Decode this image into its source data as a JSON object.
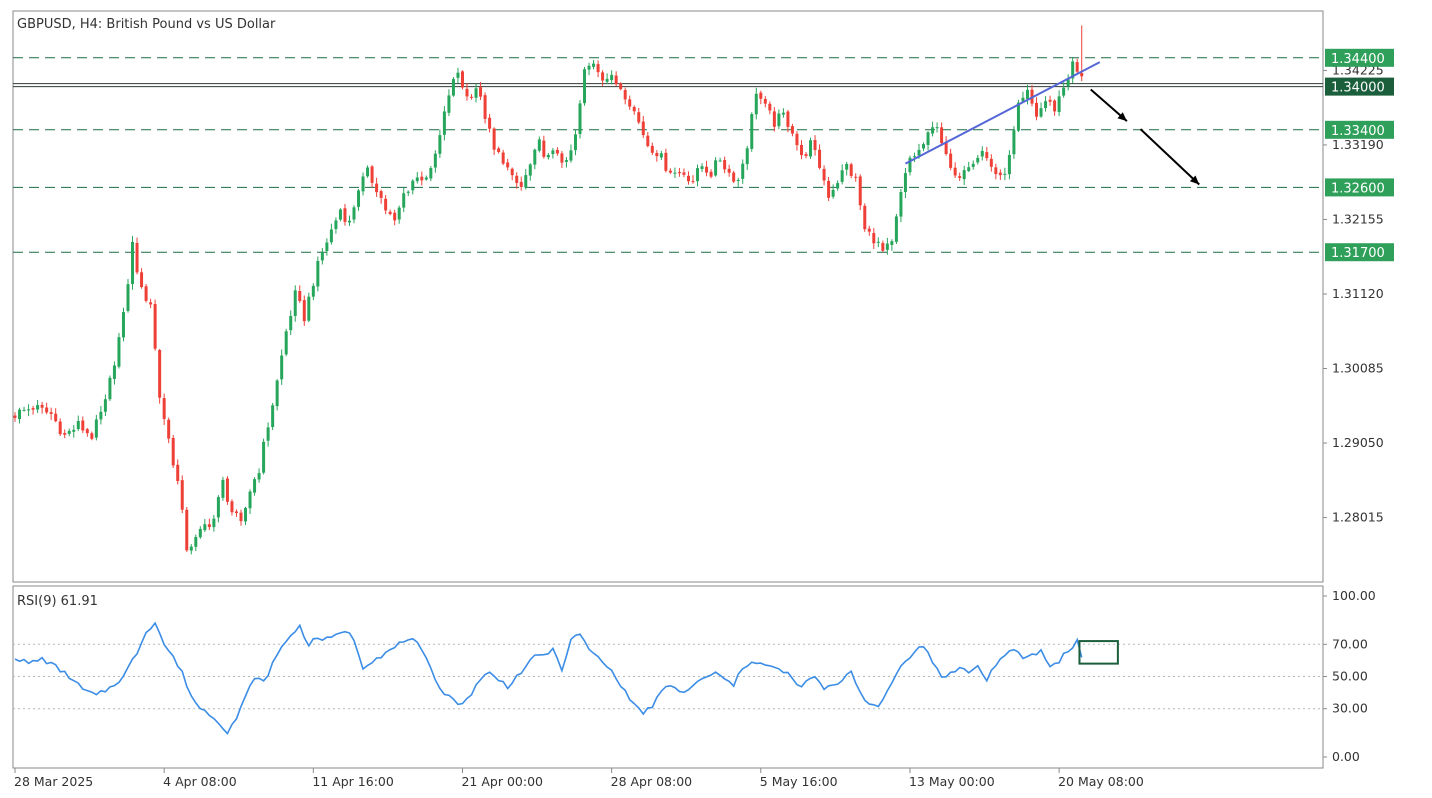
{
  "header": {
    "title": "GBPUSD, H4:  British Pound vs US Dollar"
  },
  "indicator": {
    "label": "RSI(9) 61.91"
  },
  "colors": {
    "bull": "#26a65b",
    "bear": "#ef4037",
    "grid_dash": "#1d6b45",
    "badge_fill": "#2ea05a",
    "badge_dark": "#1a5e3b",
    "trendline": "#5466d8",
    "rsi": "#3b8de6",
    "arrow": "#000000"
  },
  "chart_data": [
    {
      "type": "candlestick",
      "symbol": "GBPUSD",
      "timeframe": "H4",
      "x_ticks": [
        "28 Mar 2025",
        "4 Apr 08:00",
        "11 Apr 16:00",
        "21 Apr 00:00",
        "28 Apr 08:00",
        "5 May 16:00",
        "13 May 00:00",
        "20 May 08:00"
      ],
      "y_ticks": [
        "1.34225",
        "1.33190",
        "1.32155",
        "1.31120",
        "1.30085",
        "1.29050",
        "1.28015"
      ],
      "y_tick_values": [
        1.34225,
        1.3319,
        1.32155,
        1.3112,
        1.30085,
        1.2905,
        1.28015
      ],
      "ylim": [
        1.2712,
        1.3505
      ],
      "levels": [
        {
          "value": 1.344,
          "label": "1.34400",
          "style": "dashed"
        },
        {
          "value": 1.34,
          "label": "1.34000",
          "style": "solid"
        },
        {
          "value": 1.334,
          "label": "1.33400",
          "style": "dashed"
        },
        {
          "value": 1.326,
          "label": "1.32600",
          "style": "dashed"
        },
        {
          "value": 1.317,
          "label": "1.31700",
          "style": "dashed"
        }
      ],
      "anchors": [
        [
          0,
          1.2945
        ],
        [
          4,
          1.2955
        ],
        [
          8,
          1.2945
        ],
        [
          11,
          1.2915
        ],
        [
          14,
          1.293
        ],
        [
          17,
          1.2915
        ],
        [
          20,
          1.296
        ],
        [
          24,
          1.308
        ],
        [
          26,
          1.318
        ],
        [
          28,
          1.3115
        ],
        [
          30,
          1.31
        ],
        [
          32,
          1.297
        ],
        [
          34,
          1.291
        ],
        [
          36,
          1.285
        ],
        [
          38,
          1.276
        ],
        [
          40,
          1.277
        ],
        [
          42,
          1.279
        ],
        [
          44,
          1.28
        ],
        [
          46,
          1.285
        ],
        [
          48,
          1.281
        ],
        [
          50,
          1.279
        ],
        [
          52,
          1.284
        ],
        [
          54,
          1.287
        ],
        [
          56,
          1.293
        ],
        [
          58,
          1.299
        ],
        [
          60,
          1.306
        ],
        [
          62,
          1.311
        ],
        [
          64,
          1.308
        ],
        [
          66,
          1.313
        ],
        [
          68,
          1.317
        ],
        [
          70,
          1.32
        ],
        [
          72,
          1.323
        ],
        [
          74,
          1.321
        ],
        [
          76,
          1.326
        ],
        [
          78,
          1.328
        ],
        [
          80,
          1.326
        ],
        [
          82,
          1.323
        ],
        [
          84,
          1.321
        ],
        [
          86,
          1.325
        ],
        [
          88,
          1.327
        ],
        [
          90,
          1.3275
        ],
        [
          92,
          1.328
        ],
        [
          94,
          1.333
        ],
        [
          96,
          1.339
        ],
        [
          98,
          1.342
        ],
        [
          100,
          1.3385
        ],
        [
          102,
          1.34
        ],
        [
          104,
          1.336
        ],
        [
          106,
          1.331
        ],
        [
          108,
          1.33
        ],
        [
          110,
          1.327
        ],
        [
          112,
          1.326
        ],
        [
          114,
          1.329
        ],
        [
          116,
          1.332
        ],
        [
          118,
          1.33
        ],
        [
          120,
          1.331
        ],
        [
          122,
          1.329
        ],
        [
          124,
          1.333
        ],
        [
          126,
          1.342
        ],
        [
          128,
          1.3435
        ],
        [
          130,
          1.3415
        ],
        [
          132,
          1.341
        ],
        [
          134,
          1.34
        ],
        [
          136,
          1.338
        ],
        [
          138,
          1.335
        ],
        [
          140,
          1.332
        ],
        [
          142,
          1.331
        ],
        [
          144,
          1.329
        ],
        [
          146,
          1.328
        ],
        [
          148,
          1.328
        ],
        [
          150,
          1.327
        ],
        [
          152,
          1.329
        ],
        [
          154,
          1.328
        ],
        [
          156,
          1.33
        ],
        [
          158,
          1.328
        ],
        [
          160,
          1.327
        ],
        [
          162,
          1.332
        ],
        [
          164,
          1.3395
        ],
        [
          166,
          1.337
        ],
        [
          168,
          1.335
        ],
        [
          170,
          1.336
        ],
        [
          172,
          1.334
        ],
        [
          174,
          1.33
        ],
        [
          176,
          1.332
        ],
        [
          178,
          1.329
        ],
        [
          180,
          1.325
        ],
        [
          182,
          1.327
        ],
        [
          184,
          1.329
        ],
        [
          186,
          1.327
        ],
        [
          188,
          1.32
        ],
        [
          190,
          1.319
        ],
        [
          192,
          1.317
        ],
        [
          194,
          1.318
        ],
        [
          196,
          1.325
        ],
        [
          198,
          1.33
        ],
        [
          200,
          1.331
        ],
        [
          202,
          1.333
        ],
        [
          204,
          1.335
        ],
        [
          206,
          1.33
        ],
        [
          208,
          1.327
        ],
        [
          210,
          1.329
        ],
        [
          212,
          1.33
        ],
        [
          214,
          1.331
        ],
        [
          216,
          1.329
        ],
        [
          218,
          1.327
        ],
        [
          220,
          1.33
        ],
        [
          222,
          1.337
        ],
        [
          224,
          1.339
        ],
        [
          226,
          1.336
        ],
        [
          228,
          1.338
        ],
        [
          230,
          1.337
        ],
        [
          232,
          1.34
        ],
        [
          234,
          1.343
        ],
        [
          236,
          1.341
        ]
      ],
      "trendline": {
        "from": [
          197,
          1.3293
        ],
        "to": [
          240,
          1.3434
        ]
      },
      "projection_arrows": [
        {
          "from": [
            238,
            1.3396
          ],
          "to": [
            246,
            1.3352
          ]
        },
        {
          "from": [
            249,
            1.3341
          ],
          "to": [
            262,
            1.3264
          ]
        }
      ]
    },
    {
      "type": "line",
      "name": "RSI(9) 61.91",
      "y_ticks": [
        "100.00",
        "70.00",
        "50.00",
        "30.00",
        "0.00"
      ],
      "y_tick_values": [
        100,
        70,
        50,
        30,
        0
      ],
      "ylim": [
        0,
        100
      ],
      "levels": [
        70,
        50,
        30
      ],
      "anchors": [
        [
          0,
          62
        ],
        [
          3,
          58
        ],
        [
          6,
          61
        ],
        [
          9,
          56
        ],
        [
          12,
          50
        ],
        [
          15,
          42
        ],
        [
          18,
          38
        ],
        [
          21,
          43
        ],
        [
          24,
          50
        ],
        [
          27,
          65
        ],
        [
          29,
          78
        ],
        [
          31,
          84
        ],
        [
          33,
          70
        ],
        [
          35,
          62
        ],
        [
          37,
          52
        ],
        [
          39,
          38
        ],
        [
          41,
          30
        ],
        [
          43,
          27
        ],
        [
          45,
          22
        ],
        [
          47,
          16
        ],
        [
          49,
          24
        ],
        [
          51,
          37
        ],
        [
          53,
          50
        ],
        [
          55,
          46
        ],
        [
          57,
          58
        ],
        [
          59,
          68
        ],
        [
          61,
          76
        ],
        [
          63,
          81
        ],
        [
          65,
          70
        ],
        [
          67,
          74
        ],
        [
          69,
          73
        ],
        [
          71,
          75
        ],
        [
          73,
          79
        ],
        [
          75,
          73
        ],
        [
          77,
          56
        ],
        [
          79,
          60
        ],
        [
          81,
          63
        ],
        [
          83,
          66
        ],
        [
          85,
          70
        ],
        [
          87,
          74
        ],
        [
          89,
          70
        ],
        [
          91,
          60
        ],
        [
          93,
          48
        ],
        [
          95,
          40
        ],
        [
          97,
          36
        ],
        [
          99,
          32
        ],
        [
          101,
          40
        ],
        [
          103,
          49
        ],
        [
          105,
          52
        ],
        [
          107,
          48
        ],
        [
          109,
          44
        ],
        [
          111,
          50
        ],
        [
          113,
          56
        ],
        [
          115,
          62
        ],
        [
          117,
          64
        ],
        [
          119,
          66
        ],
        [
          121,
          55
        ],
        [
          123,
          72
        ],
        [
          125,
          77
        ],
        [
          127,
          66
        ],
        [
          129,
          62
        ],
        [
          131,
          56
        ],
        [
          133,
          50
        ],
        [
          135,
          40
        ],
        [
          137,
          33
        ],
        [
          139,
          27
        ],
        [
          141,
          32
        ],
        [
          143,
          40
        ],
        [
          145,
          45
        ],
        [
          147,
          40
        ],
        [
          149,
          42
        ],
        [
          151,
          46
        ],
        [
          153,
          50
        ],
        [
          155,
          52
        ],
        [
          157,
          48
        ],
        [
          159,
          45
        ],
        [
          161,
          55
        ],
        [
          163,
          60
        ],
        [
          165,
          58
        ],
        [
          167,
          56
        ],
        [
          169,
          54
        ],
        [
          171,
          52
        ],
        [
          173,
          44
        ],
        [
          175,
          46
        ],
        [
          177,
          50
        ],
        [
          179,
          42
        ],
        [
          181,
          44
        ],
        [
          183,
          48
        ],
        [
          185,
          54
        ],
        [
          187,
          40
        ],
        [
          189,
          33
        ],
        [
          191,
          30
        ],
        [
          193,
          41
        ],
        [
          195,
          52
        ],
        [
          197,
          60
        ],
        [
          199,
          66
        ],
        [
          201,
          69
        ],
        [
          203,
          59
        ],
        [
          205,
          50
        ],
        [
          207,
          52
        ],
        [
          209,
          55
        ],
        [
          211,
          53
        ],
        [
          213,
          56
        ],
        [
          215,
          48
        ],
        [
          217,
          58
        ],
        [
          219,
          63
        ],
        [
          221,
          66
        ],
        [
          223,
          62
        ],
        [
          225,
          63
        ],
        [
          227,
          66
        ],
        [
          229,
          56
        ],
        [
          231,
          60
        ],
        [
          233,
          66
        ],
        [
          235,
          72
        ],
        [
          236,
          62
        ]
      ],
      "marker_box": {
        "x_range": [
          235.5,
          244
        ],
        "y_range": [
          58,
          72
        ]
      }
    }
  ]
}
